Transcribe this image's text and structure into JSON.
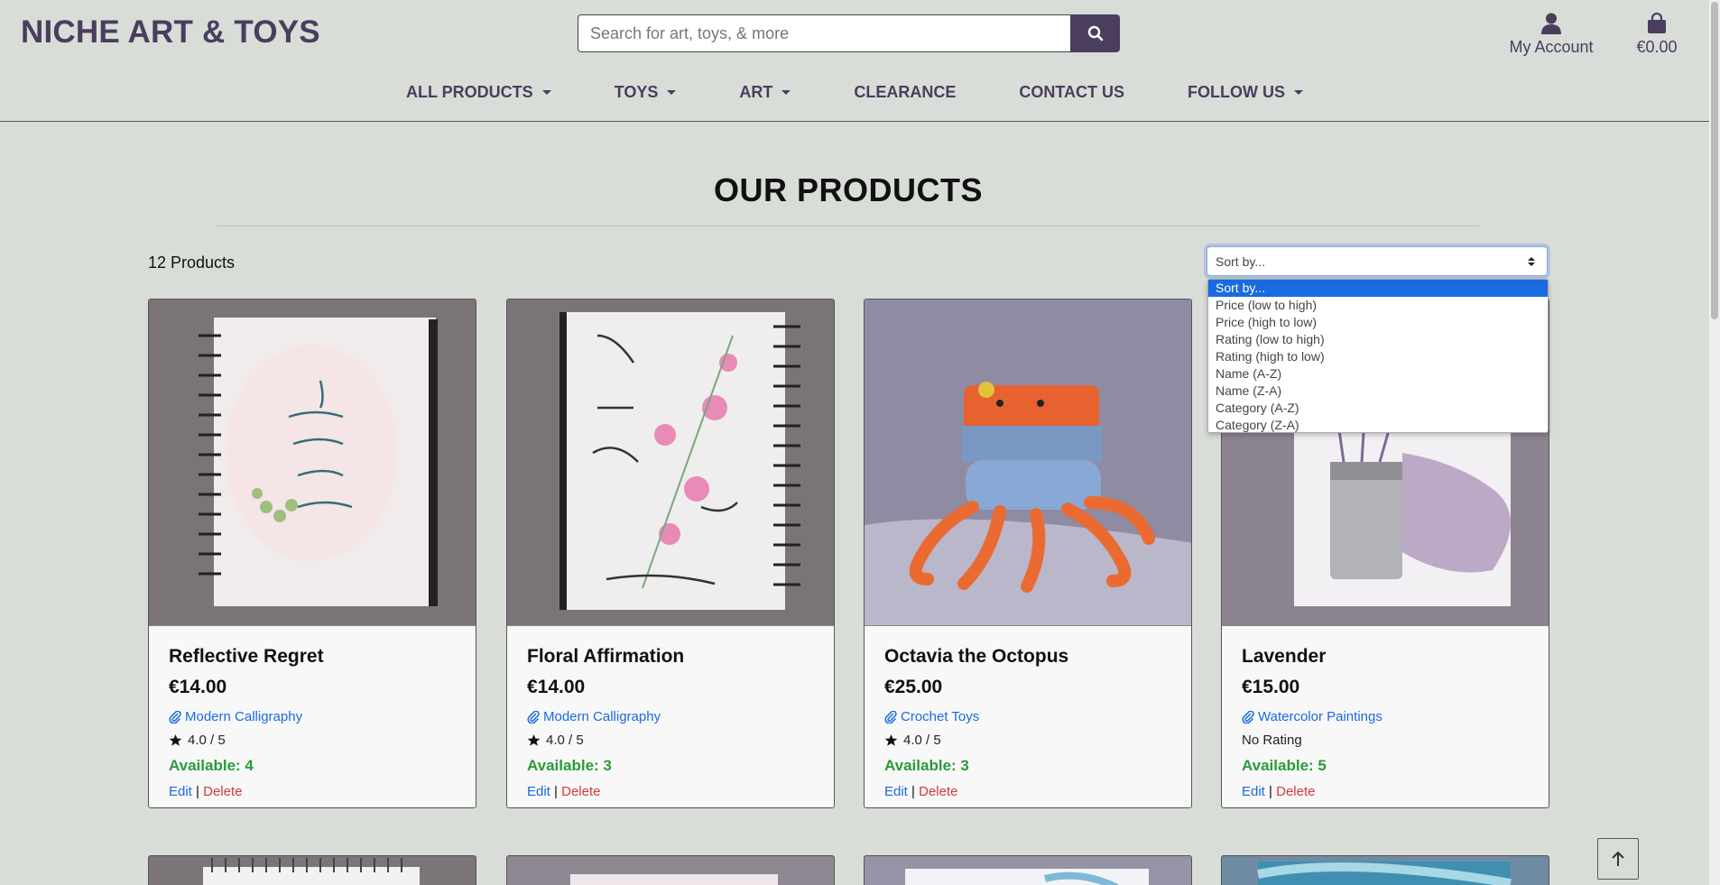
{
  "brand": "NICHE ART & TOYS",
  "search": {
    "placeholder": "Search for art, toys, & more"
  },
  "account": {
    "label": "My Account"
  },
  "cart": {
    "total": "€0.00"
  },
  "nav": [
    {
      "label": "ALL PRODUCTS",
      "dropdown": true
    },
    {
      "label": "TOYS",
      "dropdown": true
    },
    {
      "label": "ART",
      "dropdown": true
    },
    {
      "label": "CLEARANCE",
      "dropdown": false
    },
    {
      "label": "CONTACT US",
      "dropdown": false
    },
    {
      "label": "FOLLOW US",
      "dropdown": true
    }
  ],
  "main": {
    "title": "OUR PRODUCTS",
    "count": "12 Products"
  },
  "sort": {
    "selected": "Sort by...",
    "options": [
      "Sort by...",
      "Price (low to high)",
      "Price (high to low)",
      "Rating (low to high)",
      "Rating (high to low)",
      "Name (A-Z)",
      "Name (Z-A)",
      "Category (A-Z)",
      "Category (Z-A)"
    ]
  },
  "products": [
    {
      "name": "Reflective Regret",
      "price": "€14.00",
      "category": "Modern Calligraphy",
      "rating": "4.0 / 5",
      "has_rating": true,
      "available": "Available: 4",
      "edit": "Edit",
      "sep": "|",
      "delete": "Delete",
      "image": "calligraphy-notebook"
    },
    {
      "name": "Floral Affirmation",
      "price": "€14.00",
      "category": "Modern Calligraphy",
      "rating": "4.0 / 5",
      "has_rating": true,
      "available": "Available: 3",
      "edit": "Edit",
      "sep": "|",
      "delete": "Delete",
      "image": "floral-notebook"
    },
    {
      "name": "Octavia the Octopus",
      "price": "€25.00",
      "category": "Crochet Toys",
      "rating": "4.0 / 5",
      "has_rating": true,
      "available": "Available: 3",
      "edit": "Edit",
      "sep": "|",
      "delete": "Delete",
      "image": "crochet-octopus"
    },
    {
      "name": "Lavender",
      "price": "€15.00",
      "category": "Watercolor Paintings",
      "rating": "No Rating",
      "has_rating": false,
      "available": "Available: 5",
      "edit": "Edit",
      "sep": "|",
      "delete": "Delete",
      "image": "lavender-painting"
    }
  ],
  "colors": {
    "brand": "#4a3d5e",
    "background": "#d9ddd8",
    "link": "#1a6ae0",
    "available": "#2a9a3a",
    "delete": "#d23a3a"
  }
}
